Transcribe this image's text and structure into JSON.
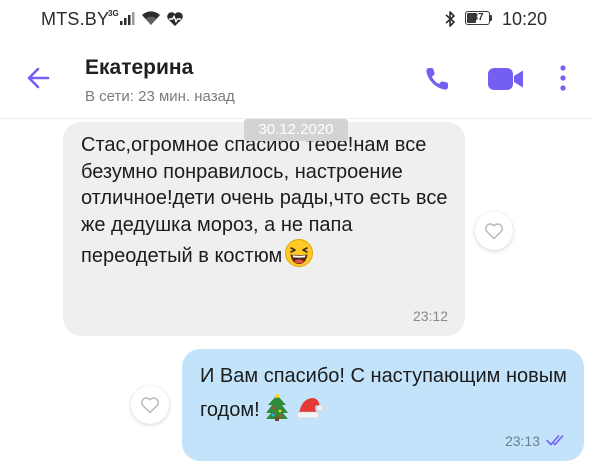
{
  "status_bar": {
    "carrier": "MTS.BY",
    "network_type": "3G",
    "battery": "37",
    "battery_level_percent": 37,
    "time": "10:20"
  },
  "header": {
    "contact_name": "Екатерина",
    "presence": "В сети: 23 мин. назад",
    "icons": {
      "back": "arrow-left-icon",
      "call": "phone-icon",
      "video": "video-camera-icon",
      "menu": "more-vert-icon"
    }
  },
  "chat": {
    "date_separator": "30.12.2020",
    "messages": [
      {
        "direction": "incoming",
        "text": "Стас,огромное спасибо  тебе!нам все безумно понравилось, настроение отличное!дети очень рады,что есть все же дедушка мороз, а не папа переодетый в костюм",
        "emoji": "😆",
        "time": "23:12"
      },
      {
        "direction": "outgoing",
        "text": "И Вам спасибо! С наступающим новым годом!",
        "emoji": [
          "🎄",
          "🎅"
        ],
        "time": "23:13",
        "status": "read"
      }
    ]
  },
  "colors": {
    "accent": "#7360f2",
    "incoming_bubble": "#efefef",
    "outgoing_bubble": "#c2e3fa",
    "date_pill": "#d3d3d3",
    "read_ticks": "#7360f2"
  }
}
